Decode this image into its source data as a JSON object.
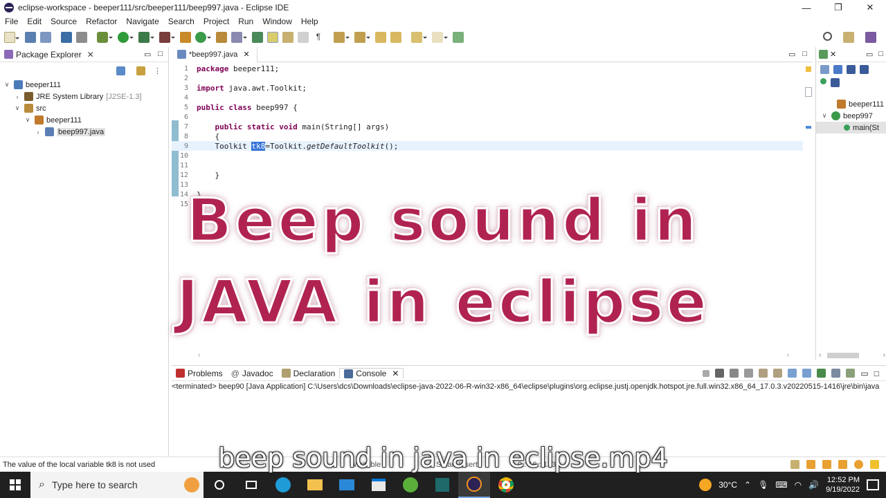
{
  "window": {
    "title": "eclipse-workspace - beeper111/src/beeper111/beep997.java - Eclipse IDE",
    "minimize": "—",
    "restore": "❐",
    "close": "✕"
  },
  "menu": [
    "File",
    "Edit",
    "Source",
    "Refactor",
    "Navigate",
    "Search",
    "Project",
    "Run",
    "Window",
    "Help"
  ],
  "package_explorer": {
    "title": "Package Explorer",
    "close": "✕",
    "tree": [
      {
        "arrow": "∨",
        "label": "beeper111",
        "extra": "",
        "indent": 0,
        "color": "#4a7bb8"
      },
      {
        "arrow": "›",
        "label": "JRE System Library",
        "extra": "[J2SE-1.3]",
        "indent": 1,
        "color": "#7a5c2e"
      },
      {
        "arrow": "∨",
        "label": "src",
        "extra": "",
        "indent": 1,
        "color": "#b98b3c"
      },
      {
        "arrow": "∨",
        "label": "beeper111",
        "extra": "",
        "indent": 2,
        "color": "#c07a2c"
      },
      {
        "arrow": "›",
        "label": "beep997.java",
        "extra": "",
        "indent": 3,
        "color": "#5b7fb5"
      }
    ]
  },
  "editor": {
    "tab": "*beep997.java",
    "tab_close": "✕",
    "lines": [
      {
        "n": "1",
        "parts": [
          {
            "t": "package",
            "c": "kw"
          },
          {
            "t": " beeper111;",
            "c": ""
          }
        ]
      },
      {
        "n": "2",
        "parts": []
      },
      {
        "n": "3",
        "parts": [
          {
            "t": "import",
            "c": "kw"
          },
          {
            "t": " java.awt.Toolkit;",
            "c": ""
          }
        ]
      },
      {
        "n": "4",
        "parts": []
      },
      {
        "n": "5",
        "parts": [
          {
            "t": "public",
            "c": "kw"
          },
          {
            "t": " ",
            "c": ""
          },
          {
            "t": "class",
            "c": "kw"
          },
          {
            "t": " beep997 {",
            "c": ""
          }
        ]
      },
      {
        "n": "6",
        "parts": []
      },
      {
        "n": "7",
        "parts": [
          {
            "t": "    ",
            "c": ""
          },
          {
            "t": "public",
            "c": "kw"
          },
          {
            "t": " ",
            "c": ""
          },
          {
            "t": "static",
            "c": "kw"
          },
          {
            "t": " ",
            "c": ""
          },
          {
            "t": "void",
            "c": "kw"
          },
          {
            "t": " main(String[] args)",
            "c": ""
          }
        ]
      },
      {
        "n": "8",
        "parts": [
          {
            "t": "    {",
            "c": ""
          }
        ]
      },
      {
        "n": "9",
        "parts": [
          {
            "t": "    Toolkit ",
            "c": ""
          },
          {
            "t": "tk8",
            "c": "hl"
          },
          {
            "t": "=Toolkit.",
            "c": ""
          },
          {
            "t": "getDefaultToolkit",
            "c": "it"
          },
          {
            "t": "();",
            "c": ""
          }
        ]
      },
      {
        "n": "10",
        "parts": []
      },
      {
        "n": "11",
        "parts": []
      },
      {
        "n": "12",
        "parts": [
          {
            "t": "    }",
            "c": ""
          }
        ]
      },
      {
        "n": "13",
        "parts": []
      },
      {
        "n": "14",
        "parts": [
          {
            "t": "}",
            "c": ""
          }
        ]
      },
      {
        "n": "15",
        "parts": []
      }
    ]
  },
  "outline": {
    "items": [
      {
        "label": "beeper111"
      },
      {
        "label": "beep997"
      },
      {
        "label": "main(St"
      }
    ]
  },
  "console": {
    "tabs": [
      "Problems",
      "Javadoc",
      "Declaration",
      "Console"
    ],
    "line": "<terminated> beep90 [Java Application] C:\\Users\\dcs\\Downloads\\eclipse-java-2022-06-R-win32-x86_64\\eclipse\\plugins\\org.eclipse.justj.openjdk.hotspot.jre.full.win32.x86_64_17.0.3.v20220515-1416\\jre\\bin\\java"
  },
  "status": {
    "message": "The value of the local variable tk8 is not used",
    "writable": "Writable",
    "insert": "Smart Insert",
    "position": "9 : 16 : 133"
  },
  "overlay": {
    "line1": "Beep sound in",
    "line2": "JAVA in eclipse"
  },
  "subtitle": "beep sound in java in eclipse.mp4",
  "taskbar": {
    "search_placeholder": "Type here to search",
    "temperature": "30°C",
    "time": "12:52 PM",
    "date": "9/19/2022"
  }
}
